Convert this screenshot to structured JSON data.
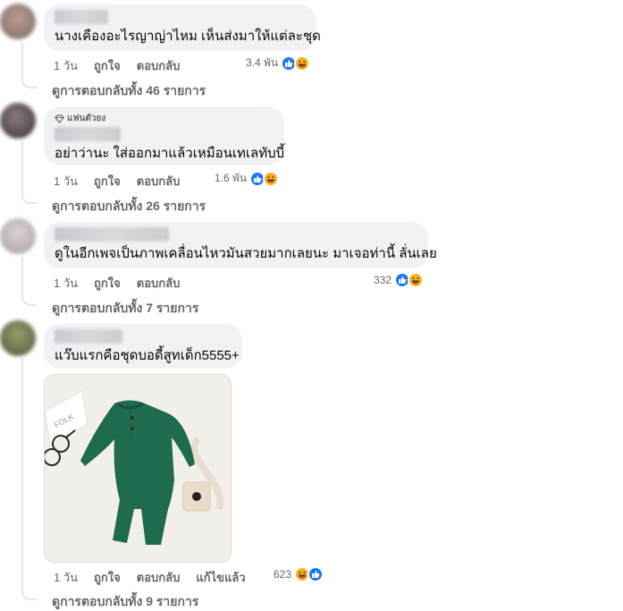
{
  "comments": [
    {
      "text": "นางเคืองอะไรญาญ่าไหม เห็นส่งมาให้แต่ละชุด",
      "time": "1 วัน",
      "like_label": "ถูกใจ",
      "reply_label": "ตอบกลับ",
      "reaction_count": "3.4 พัน",
      "reactions": [
        "like-icon",
        "haha-icon"
      ],
      "view_replies": "ดูการตอบกลับทั้ง 46 รายการ"
    },
    {
      "badge": "แฟนตัวยง",
      "text": "อย่าว่านะ ใส่ออกมาแล้วเหมือนเทเลทับบี้",
      "time": "1 วัน",
      "like_label": "ถูกใจ",
      "reply_label": "ตอบกลับ",
      "reaction_count": "1.6 พัน",
      "reactions": [
        "like-icon",
        "haha-icon"
      ],
      "view_replies": "ดูการตอบกลับทั้ง 26 รายการ"
    },
    {
      "text": "ดูในอีกเพจเป็นภาพเคลื่อนไหวมันสวยมากเลยนะ มาเจอท่านี้ ลั่นเลย",
      "time": "1 วัน",
      "like_label": "ถูกใจ",
      "reply_label": "ตอบกลับ",
      "reaction_count": "332",
      "reactions": [
        "like-icon",
        "haha-icon"
      ],
      "view_replies": "ดูการตอบกลับทั้ง 7 รายการ"
    },
    {
      "text": "แว๊บแรกคือชุดบอดี้สูทเด็ก5555+",
      "time": "1 วัน",
      "like_label": "ถูกใจ",
      "reply_label": "ตอบกลับ",
      "edited_label": "แก้ไขแล้ว",
      "reaction_count": "623",
      "reactions": [
        "haha-icon",
        "like-icon"
      ],
      "view_replies": "ดูการตอบกลับทั้ง 9 รายการ",
      "photo_print": "FOLK"
    }
  ],
  "colors": {
    "bubble": "#f0f2f5",
    "secondary_text": "#65676b",
    "like_blue": "#1877f2",
    "haha_yellow": "#f7b125",
    "romper_green": "#1f6b4e"
  }
}
